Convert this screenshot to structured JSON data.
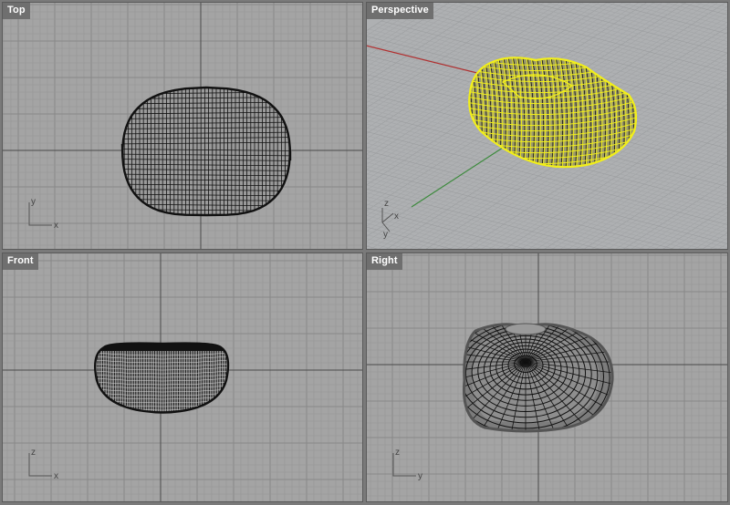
{
  "viewports": {
    "top": {
      "title": "Top",
      "axis_h": "x",
      "axis_v": "y"
    },
    "perspective": {
      "title": "Perspective",
      "axis_a": "x",
      "axis_b": "y",
      "axis_c": "z"
    },
    "front": {
      "title": "Front",
      "axis_h": "x",
      "axis_v": "z"
    },
    "right": {
      "title": "Right",
      "axis_h": "y",
      "axis_v": "z"
    }
  },
  "colors": {
    "viewport_bg": "#a4a4a4",
    "perspective_bg": "#aeb0b2",
    "grid_minor": "#959595",
    "grid_major": "#888888",
    "world_axis": "#4a4a4a",
    "x_axis_red": "#b03030",
    "y_axis_green": "#3c8a3c",
    "wire_black": "#111111",
    "wire_selected": "#f2ef1a",
    "label_bg": "#6f6f6f"
  },
  "icons": {
    "top_axes": "axes-icon",
    "perspective_axes": "axes-icon",
    "front_axes": "axes-icon",
    "right_axes": "axes-icon"
  }
}
